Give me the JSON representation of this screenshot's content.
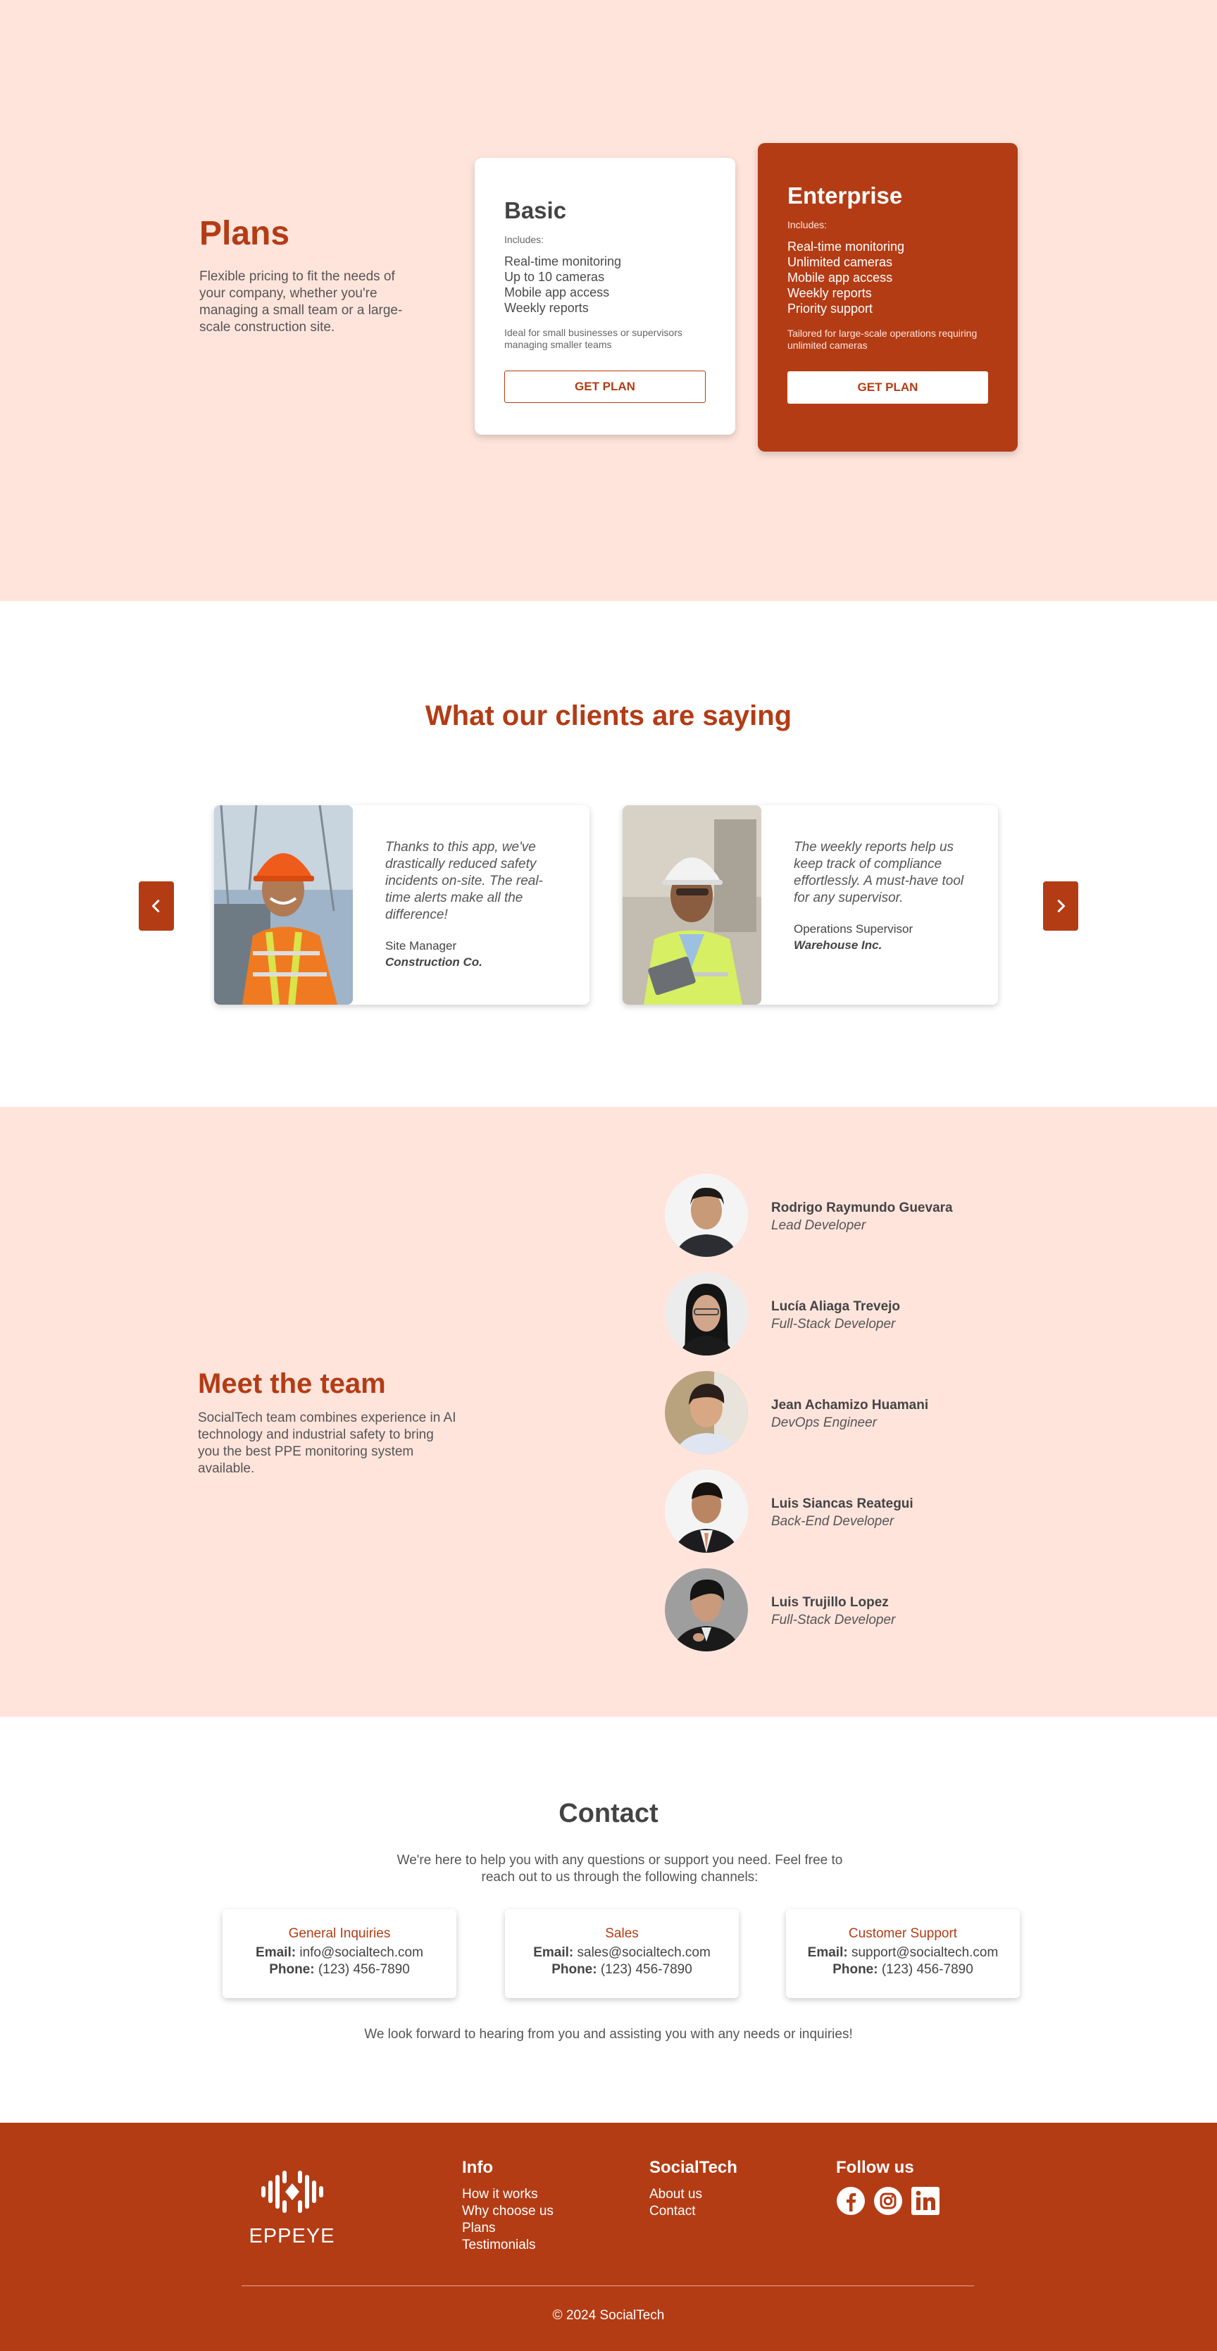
{
  "plans": {
    "title": "Plans",
    "subtitle": "Flexible pricing to fit the needs of your company, whether you're managing a small team or a large-scale construction site.",
    "basic": {
      "name": "Basic",
      "includes": "Includes:",
      "features": [
        "Real-time monitoring",
        "Up to 10 cameras",
        "Mobile app access",
        "Weekly reports"
      ],
      "description": "Ideal for small businesses or supervisors managing smaller teams",
      "button": "GET PLAN"
    },
    "enterprise": {
      "name": "Enterprise",
      "includes": "Includes:",
      "features": [
        "Real-time monitoring",
        "Unlimited cameras",
        "Mobile app access",
        "Weekly reports",
        "Priority support"
      ],
      "description": "Tailored for large-scale operations requiring unlimited cameras",
      "button": "GET PLAN"
    }
  },
  "testimonials": {
    "title": "What our clients are saying",
    "items": [
      {
        "quote": "Thanks to this app, we've drastically reduced safety incidents on-site. The real-time alerts make all the difference!",
        "role": "Site Manager",
        "company": "Construction Co."
      },
      {
        "quote": "The weekly reports help us keep track of compliance effortlessly. A must-have tool for any supervisor.",
        "role": "Operations Supervisor",
        "company": "Warehouse Inc."
      }
    ]
  },
  "team": {
    "title": "Meet the team",
    "subtitle": "SocialTech team combines experience in AI technology and industrial safety to bring you the best PPE monitoring system available.",
    "members": [
      {
        "name": "Rodrigo Raymundo Guevara",
        "role": "Lead Developer"
      },
      {
        "name": "Lucía Aliaga Trevejo",
        "role": "Full-Stack Developer"
      },
      {
        "name": "Jean Achamizo Huamani",
        "role": "DevOps Engineer"
      },
      {
        "name": "Luis Siancas Reategui",
        "role": "Back-End Developer"
      },
      {
        "name": "Luis Trujillo Lopez",
        "role": "Full-Stack Developer"
      }
    ]
  },
  "contact": {
    "title": "Contact",
    "lead": "We're here to help you with any questions or support you need. Feel free to reach out to us through the following channels:",
    "email_label": "Email:",
    "phone_label": "Phone:",
    "channels": [
      {
        "title": "General Inquiries",
        "email": "info@socialtech.com",
        "phone": "(123) 456-7890"
      },
      {
        "title": "Sales",
        "email": "sales@socialtech.com",
        "phone": "(123) 456-7890"
      },
      {
        "title": "Customer Support",
        "email": "support@socialtech.com",
        "phone": "(123) 456-7890"
      }
    ],
    "closing": "We look forward to hearing from you and assisting you with any needs or inquiries!"
  },
  "footer": {
    "logo_text": "EPPEYE",
    "info": {
      "title": "Info",
      "links": [
        "How it works",
        "Why choose us",
        "Plans",
        "Testimonials"
      ]
    },
    "socialtech": {
      "title": "SocialTech",
      "links": [
        "About us",
        "Contact"
      ]
    },
    "follow": {
      "title": "Follow us",
      "icons": [
        "facebook-icon",
        "instagram-icon",
        "linkedin-icon"
      ]
    },
    "copyright": "© 2024 SocialTech"
  },
  "colors": {
    "brand": "#b33c15",
    "section_bg": "#ffe4dc"
  }
}
